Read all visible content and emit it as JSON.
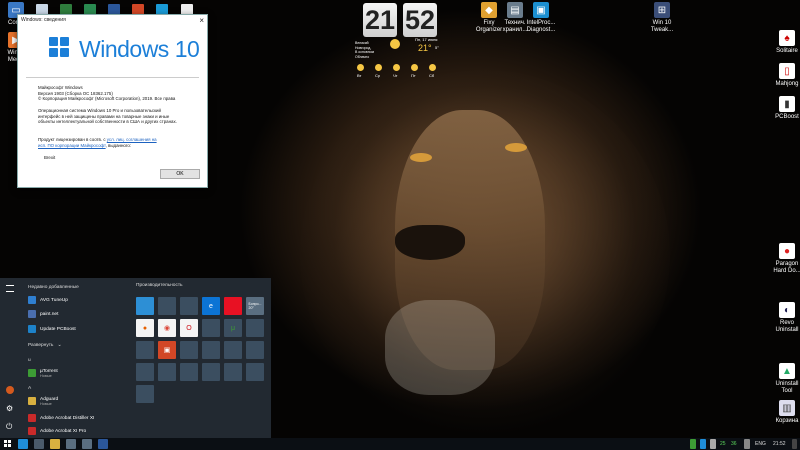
{
  "desktop_icons": {
    "computer": "Comp",
    "media": "Windo\nMedia",
    "fix_organizer": "Fixy\nOrganizer",
    "tech_storage": "Технич.\nхранил...",
    "intel": "IntelProc...\nDiagnost...",
    "win10_tweaker": "Win 10\nTweak...",
    "solitaire": "Solitaire",
    "mahjong": "Mahjong",
    "pcboost": "PCBoost",
    "paragon": "Paragon\nHard Do...",
    "revo": "Revo\nUninstall",
    "uninstall_tool": "Uninstall\nTool",
    "recycle_bin": "Корзина"
  },
  "about_dialog": {
    "title": "Windows: сведения",
    "logo_text": "Windows 10",
    "line1": "Майкрософт Windows",
    "line2": "Версия 1903 (Сборка ОС 18362.175)",
    "line3": "© Корпорация Майкрософт (Microsoft Corporation), 2019. Все права",
    "para1": "Операционная система Windows 10 Pro и пользовательский",
    "para2": "интерфейс в ней защищены правами на товарные знаки и иные",
    "para3": "объекты интеллектуальной собственности в США и других странах.",
    "lic1": "Продукт лицензирован в соотв. с",
    "lic_link1": "усл. лиц. соглашения на",
    "lic2": "исп. ПО корпорации Майкрософт",
    "lic3": ", выданного:",
    "user": "Brexit",
    "ok_label": "OK"
  },
  "clock": {
    "hours": "21",
    "minutes": "52"
  },
  "weather": {
    "date": "Пн, 17 июня",
    "city": "Великий\nНовгород,\nВ основном\nОблачно",
    "temp": "21°",
    "temp_low": "5°",
    "forecast": [
      "Вт",
      "Ср",
      "Чт",
      "Пт",
      "Сб"
    ]
  },
  "start_menu": {
    "recent_header": "Недавно добавленные",
    "recent": [
      "AVG TuneUp",
      "paint.net",
      "Update PCBoost"
    ],
    "expand": "Развернуть",
    "letter_u": "u",
    "utorrent": "µTorrent",
    "utorrent_sub": "Новые",
    "letter_a": "A",
    "adguard": "Adguard",
    "adguard_sub": "Новые",
    "acrobat_distiller": "Adobe Acrobat Distiller XI",
    "acrobat_pro": "Adobe Acrobat XI Pro",
    "tiles_header": "Производительность",
    "weather_tile": "Бопро...\n20°"
  },
  "tray": {
    "lang": "ENG",
    "time": "21:52",
    "num1": "25",
    "num2": "36"
  },
  "colors": {
    "accent": "#1c7fd8",
    "startmenu": "#242c34",
    "taskbar": "#0b0f14"
  }
}
